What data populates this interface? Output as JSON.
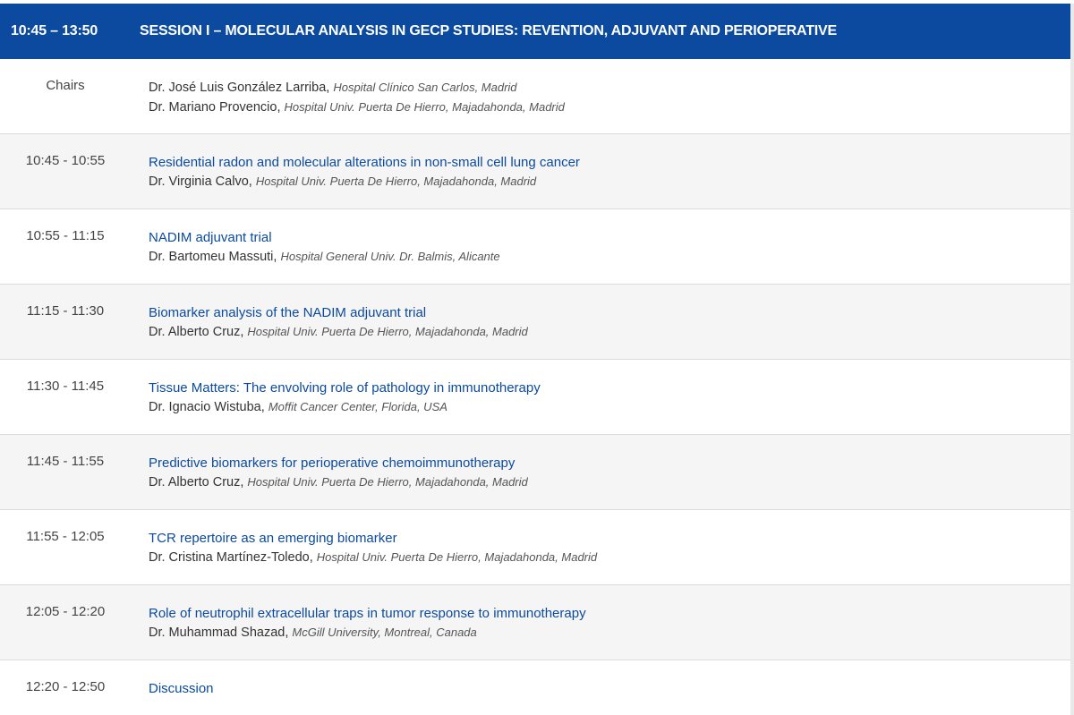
{
  "session": {
    "time": "10:45 – 13:50",
    "title": "SESSION I – MOLECULAR ANALYSIS IN GECP STUDIES: REVENTION, ADJUVANT AND PERIOPERATIVE"
  },
  "chairs": {
    "label": "Chairs",
    "people": [
      {
        "name": "Dr. José Luis González Larriba,",
        "affiliation": "Hospital Clínico San Carlos, Madrid"
      },
      {
        "name": "Dr. Mariano Provencio,",
        "affiliation": "Hospital Univ. Puerta De Hierro, Majadahonda, Madrid"
      }
    ]
  },
  "talks": [
    {
      "time": "10:45 - 10:55",
      "title": "Residential radon and molecular alterations in non-small cell lung cancer",
      "speaker": "Dr. Virginia Calvo,",
      "affiliation": "Hospital Univ. Puerta De Hierro, Majadahonda, Madrid"
    },
    {
      "time": "10:55 - 11:15",
      "title": "NADIM adjuvant trial",
      "speaker": "Dr. Bartomeu Massuti,",
      "affiliation": "Hospital General Univ. Dr. Balmis, Alicante"
    },
    {
      "time": "11:15 - 11:30",
      "title": "Biomarker analysis of the NADIM adjuvant trial",
      "speaker": "Dr. Alberto Cruz,",
      "affiliation": "Hospital Univ. Puerta De Hierro, Majadahonda, Madrid"
    },
    {
      "time": "11:30 - 11:45",
      "title": "Tissue Matters: The envolving role of pathology in immunotherapy",
      "speaker": "Dr. Ignacio Wistuba,",
      "affiliation": "Moffit Cancer Center, Florida, USA"
    },
    {
      "time": "11:45 - 11:55",
      "title": "Predictive biomarkers for perioperative chemoimmunotherapy",
      "speaker": "Dr. Alberto Cruz,",
      "affiliation": "Hospital Univ. Puerta De Hierro, Majadahonda, Madrid"
    },
    {
      "time": "11:55 - 12:05",
      "title": "TCR repertoire as an emerging biomarker",
      "speaker": "Dr. Cristina Martínez-Toledo,",
      "affiliation": "Hospital Univ. Puerta De Hierro, Majadahonda, Madrid"
    },
    {
      "time": "12:05 - 12:20",
      "title": "Role of neutrophil extracellular traps in tumor response to immunotherapy",
      "speaker": "Dr. Muhammad Shazad,",
      "affiliation": "McGill University, Montreal, Canada"
    },
    {
      "time": "12:20 - 12:50",
      "title": "Discussion",
      "speaker": "",
      "affiliation": ""
    }
  ],
  "colors": {
    "header_bg": "#0b4a9e",
    "title_blue": "#0b4a9e",
    "alt_row": "#f5f5f5"
  }
}
